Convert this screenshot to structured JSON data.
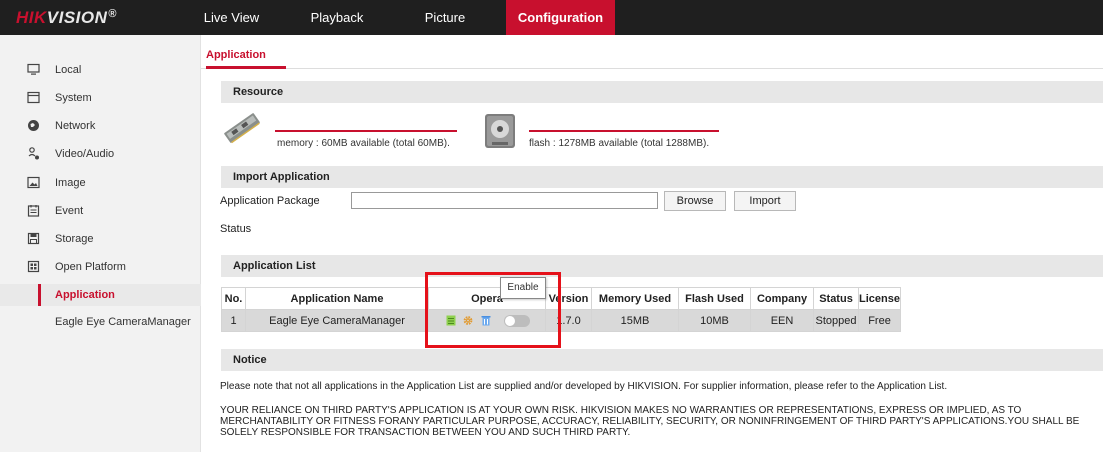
{
  "logo": {
    "brand_red": "HIK",
    "brand_white": "VISION",
    "registered": "®"
  },
  "topnav": [
    {
      "label": "Live View"
    },
    {
      "label": "Playback"
    },
    {
      "label": "Picture"
    },
    {
      "label": "Configuration"
    }
  ],
  "sidebar": {
    "items": [
      {
        "label": "Local",
        "icon": "monitor-icon"
      },
      {
        "label": "System",
        "icon": "system-icon"
      },
      {
        "label": "Network",
        "icon": "network-icon"
      },
      {
        "label": "Video/Audio",
        "icon": "video-audio-icon"
      },
      {
        "label": "Image",
        "icon": "image-icon"
      },
      {
        "label": "Event",
        "icon": "event-icon"
      },
      {
        "label": "Storage",
        "icon": "storage-icon"
      },
      {
        "label": "Open Platform",
        "icon": "open-platform-icon"
      }
    ],
    "sub_items": [
      {
        "label": "Application"
      },
      {
        "label": "Eagle Eye CameraManager"
      }
    ]
  },
  "main": {
    "tab": "Application",
    "resource": {
      "title": "Resource",
      "memory_text": "memory : 60MB available (total 60MB).",
      "flash_text": "flash : 1278MB available (total 1288MB)."
    },
    "import": {
      "title": "Import Application",
      "package_label": "Application Package",
      "package_value": "",
      "browse_label": "Browse",
      "import_label": "Import",
      "status_label": "Status"
    },
    "app_list": {
      "title": "Application List",
      "headers": [
        "No.",
        "Application Name",
        "Opera",
        "Version",
        "Memory Used",
        "Flash Used",
        "Company",
        "Status",
        "License"
      ],
      "rows": [
        {
          "no": "1",
          "name": "Eagle Eye CameraManager",
          "version": "1.7.0",
          "memory": "15MB",
          "flash": "10MB",
          "company": "EEN",
          "status": "Stopped",
          "license": "Free"
        }
      ],
      "tooltip": "Enable"
    },
    "notice": {
      "title": "Notice",
      "paragraph1": "Please note that not all applications in the Application List are supplied and/or developed by HIKVISION. For supplier information, please refer to the Application List.",
      "paragraph2": "YOUR RELIANCE ON THIRD PARTY'S APPLICATION IS AT YOUR OWN RISK. HIKVISION MAKES NO WARRANTIES OR REPRESENTATIONS, EXPRESS OR IMPLIED, AS TO MERCHANTABILITY OR FITNESS FORANY PARTICULAR PURPOSE, ACCURACY, RELIABILITY, SECURITY, OR NONINFRINGEMENT OF THIRD PARTY'S APPLICATIONS.YOU SHALL BE SOLELY RESPONSIBLE FOR TRANSACTION BETWEEN YOU AND SUCH THIRD PARTY."
    }
  },
  "colors": {
    "accent": "#c8102e",
    "topbar": "#1f1f1f",
    "sidebar": "#f2f2f2",
    "section_bar": "#e7e7e7",
    "highlight": "#e5111a"
  }
}
